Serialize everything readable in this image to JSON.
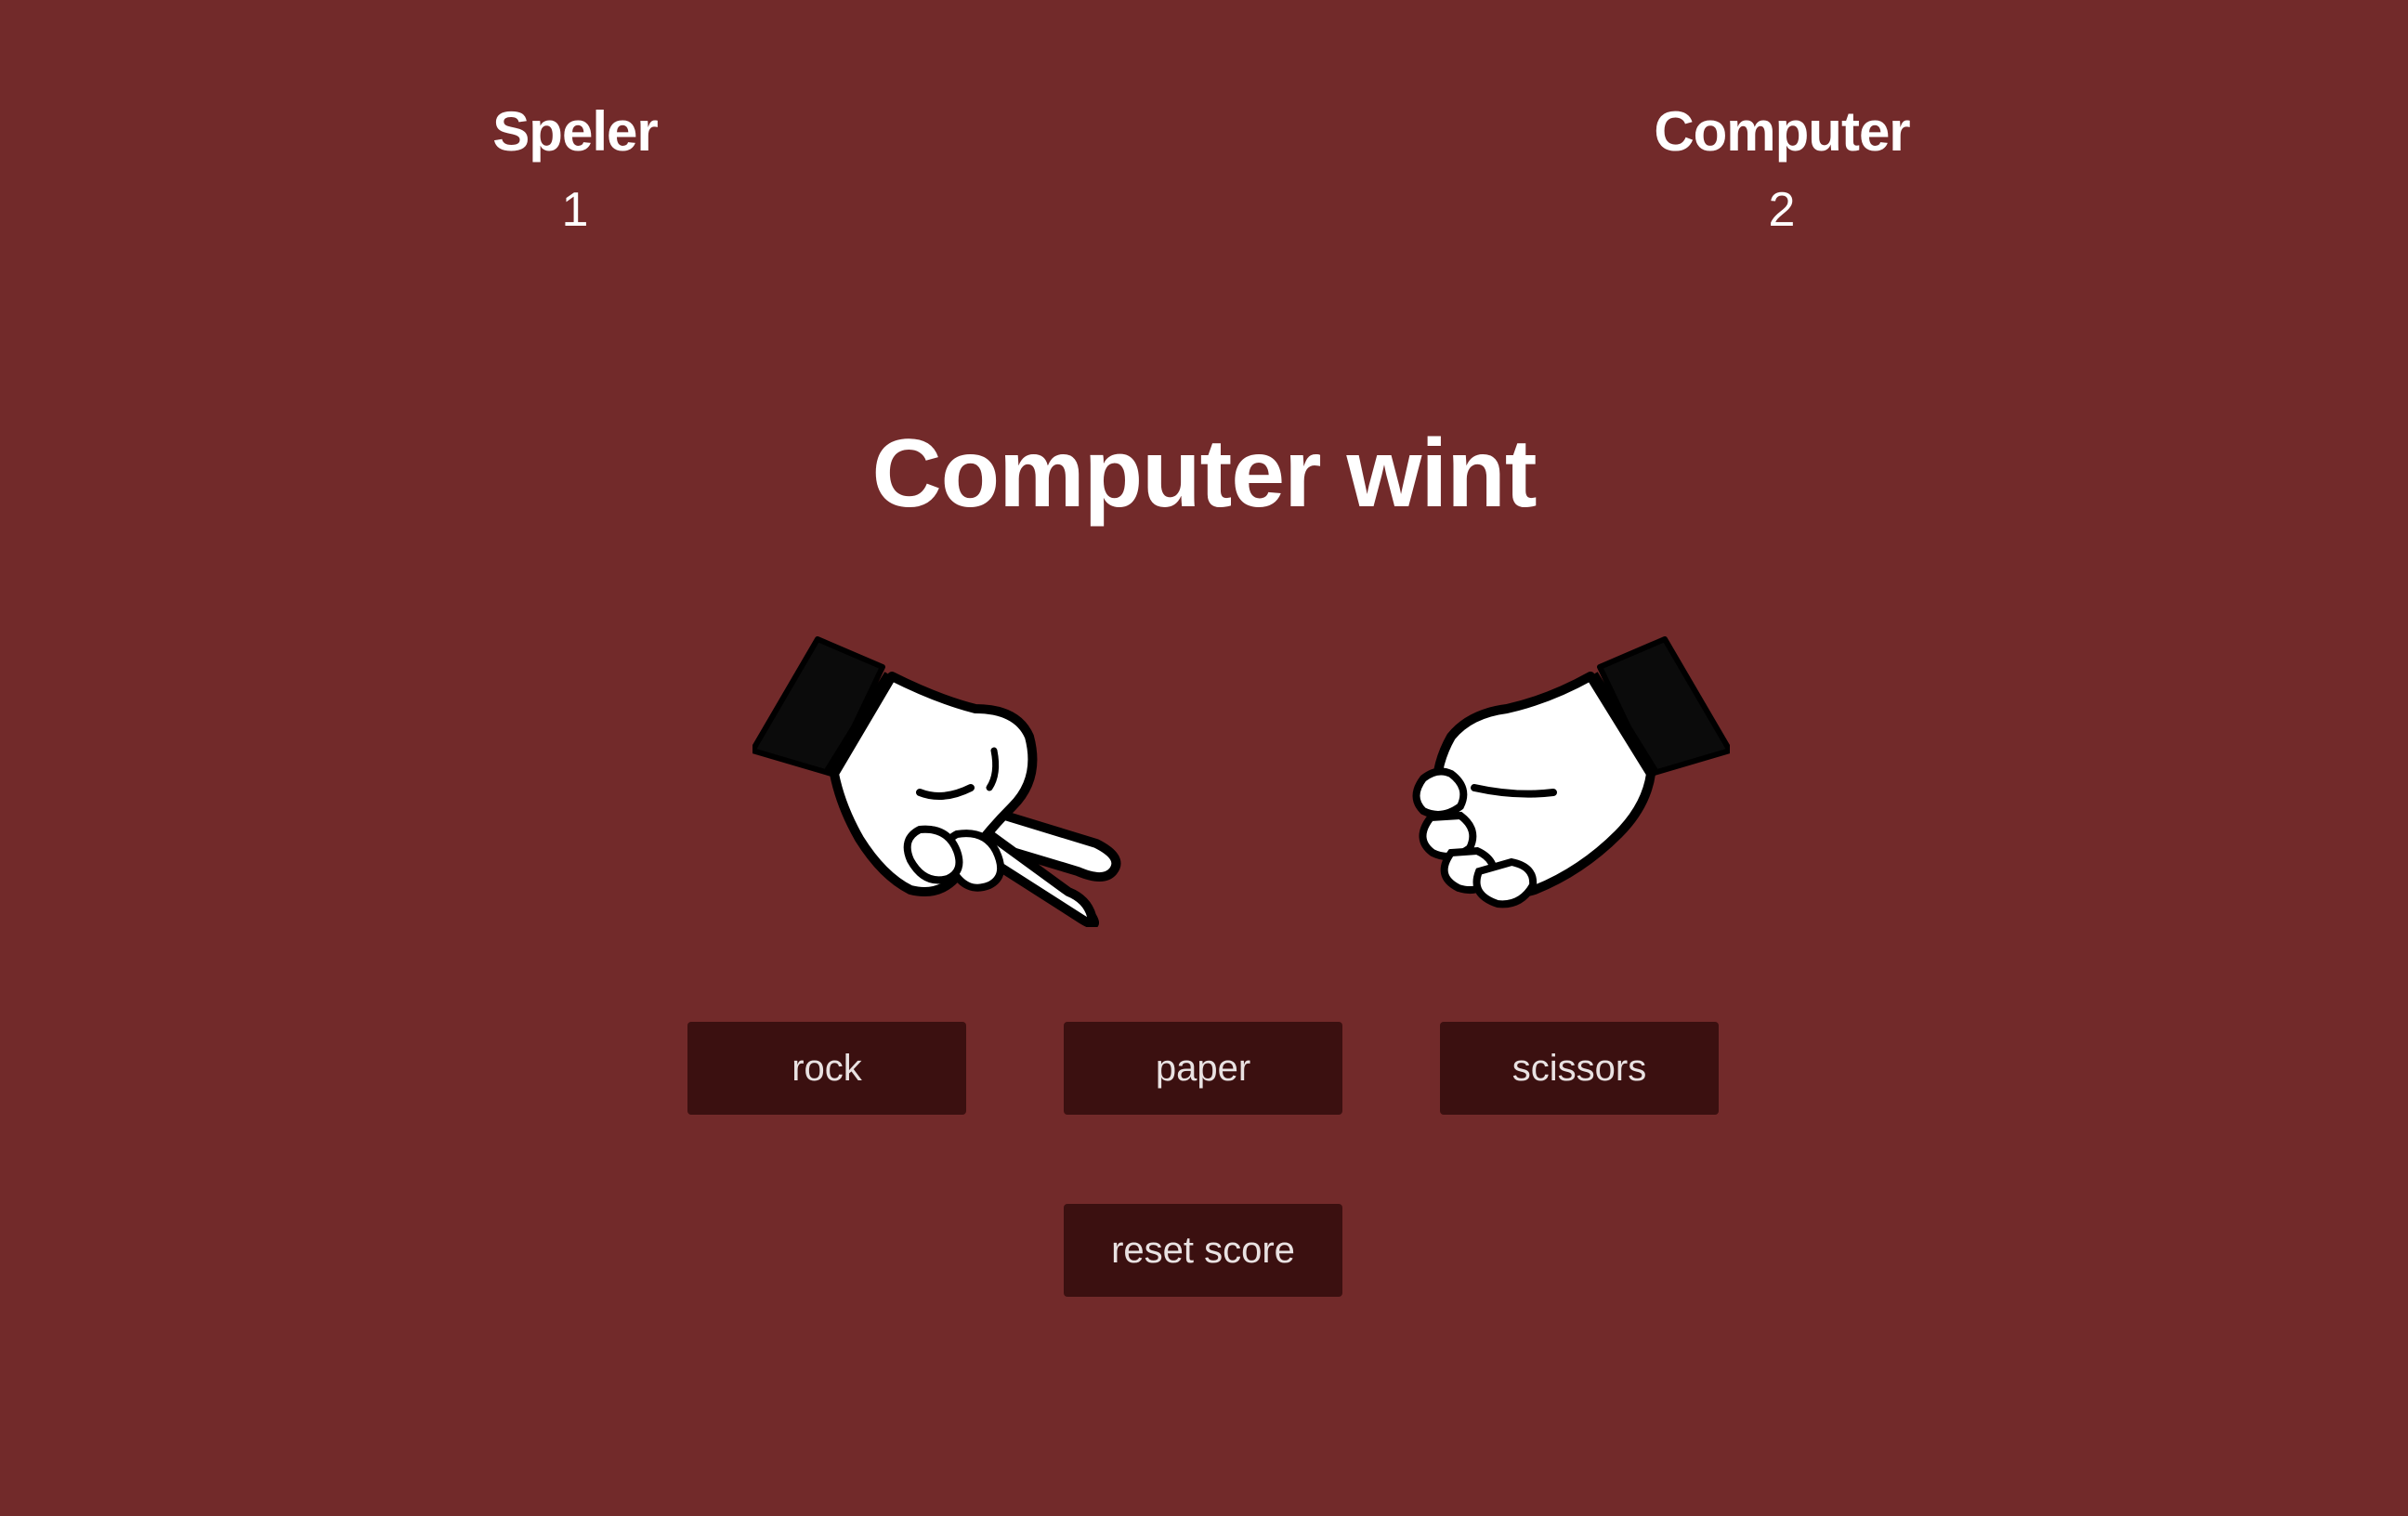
{
  "scoreboard": {
    "player": {
      "label": "Speler",
      "score": "1"
    },
    "computer": {
      "label": "Computer",
      "score": "2"
    }
  },
  "result_text": "Computer wint",
  "hands": {
    "player_choice": "scissors-hand-icon",
    "computer_choice": "rock-hand-icon"
  },
  "controls": {
    "rock_label": "rock",
    "paper_label": "paper",
    "scissors_label": "scissors",
    "reset_label": "reset score"
  },
  "colors": {
    "background": "#722a2a",
    "button": "#3b1010",
    "text": "#ffffff"
  }
}
